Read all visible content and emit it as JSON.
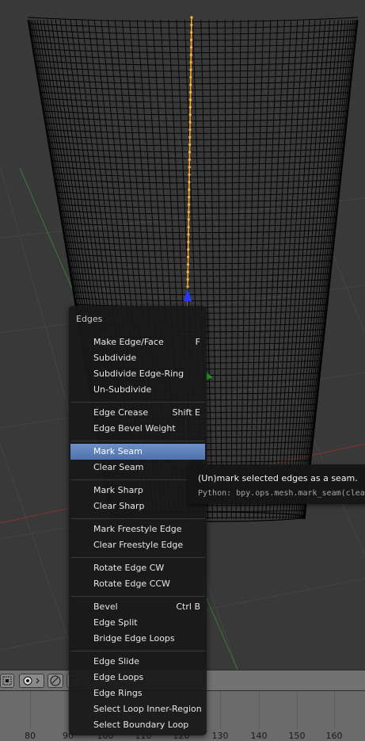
{
  "menu": {
    "title": "Edges",
    "items": [
      {
        "label": "Make Edge/Face",
        "shortcut": "F"
      },
      {
        "label": "Subdivide",
        "shortcut": ""
      },
      {
        "label": "Subdivide Edge-Ring",
        "shortcut": ""
      },
      {
        "label": "Un-Subdivide",
        "shortcut": ""
      },
      {
        "label": "Edge Crease",
        "shortcut": "Shift E"
      },
      {
        "label": "Edge Bevel Weight",
        "shortcut": ""
      },
      {
        "label": "Mark Seam",
        "shortcut": "",
        "active": true
      },
      {
        "label": "Clear Seam",
        "shortcut": ""
      },
      {
        "label": "Mark Sharp",
        "shortcut": ""
      },
      {
        "label": "Clear Sharp",
        "shortcut": ""
      },
      {
        "label": "Mark Freestyle Edge",
        "shortcut": ""
      },
      {
        "label": "Clear Freestyle Edge",
        "shortcut": ""
      },
      {
        "label": "Rotate Edge CW",
        "shortcut": ""
      },
      {
        "label": "Rotate Edge CCW",
        "shortcut": ""
      },
      {
        "label": "Bevel",
        "shortcut": "Ctrl B"
      },
      {
        "label": "Edge Split",
        "shortcut": ""
      },
      {
        "label": "Bridge Edge Loops",
        "shortcut": ""
      },
      {
        "label": "Edge Slide",
        "shortcut": ""
      },
      {
        "label": "Edge Loops",
        "shortcut": ""
      },
      {
        "label": "Edge Rings",
        "shortcut": ""
      },
      {
        "label": "Select Loop Inner-Region",
        "shortcut": ""
      },
      {
        "label": "Select Boundary Loop",
        "shortcut": ""
      }
    ]
  },
  "tooltip": {
    "description": "(Un)mark selected edges as a seam.",
    "python": "Python: bpy.ops.mesh.mark_seam(clea"
  },
  "timeline": {
    "frame_labels": [
      "80",
      "90",
      "100",
      "110",
      "120",
      "130",
      "140",
      "150",
      "160"
    ]
  },
  "colors": {
    "viewport_bg": "#393939",
    "mesh_wire": "#000000",
    "selected_edge": "#f5a623",
    "menu_highlight": "#5b7fbf",
    "axis_red": "#8a3030",
    "axis_green": "#3a7a3a",
    "gizmo_blue": "#1f3cff",
    "gizmo_green": "#22aa22"
  },
  "icons": [
    "border-select-icon",
    "pivot-point-icon",
    "proportional-edit-icon",
    "snap-icon"
  ]
}
